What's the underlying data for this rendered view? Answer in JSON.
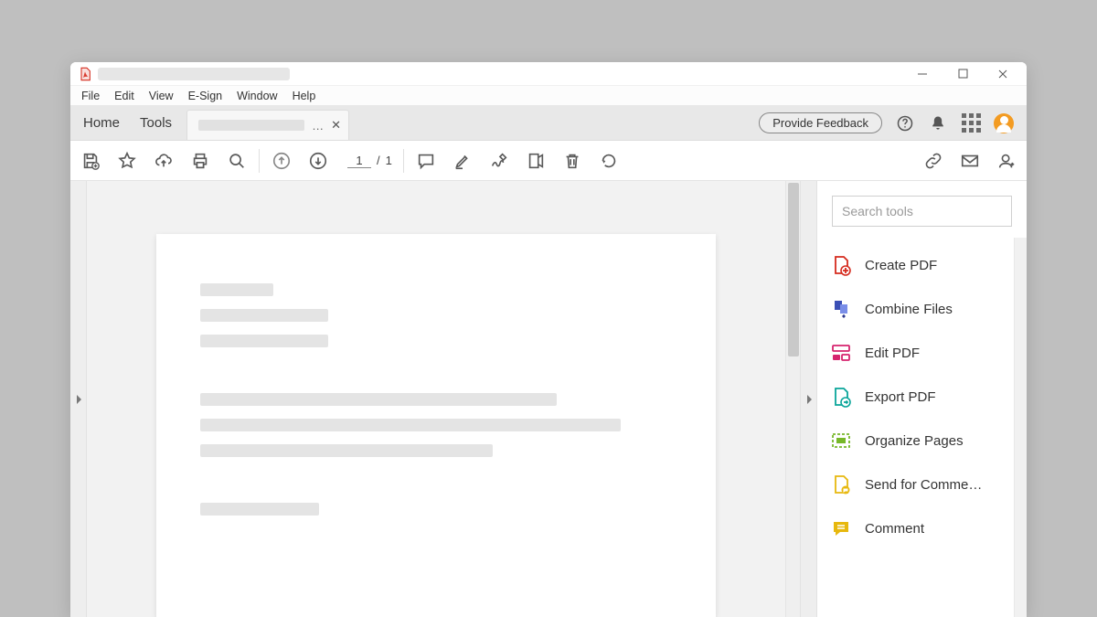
{
  "menubar": [
    "File",
    "Edit",
    "View",
    "E-Sign",
    "Window",
    "Help"
  ],
  "tabs": {
    "home": "Home",
    "tools": "Tools",
    "doc_ellipsis": "…"
  },
  "header": {
    "feedback": "Provide Feedback"
  },
  "page": {
    "current": "1",
    "sep": "/",
    "total": "1"
  },
  "search": {
    "placeholder": "Search tools"
  },
  "tools": [
    {
      "label": "Create PDF"
    },
    {
      "label": "Combine Files"
    },
    {
      "label": "Edit PDF"
    },
    {
      "label": "Export PDF"
    },
    {
      "label": "Organize Pages"
    },
    {
      "label": "Send for Comme…"
    },
    {
      "label": "Comment"
    }
  ]
}
